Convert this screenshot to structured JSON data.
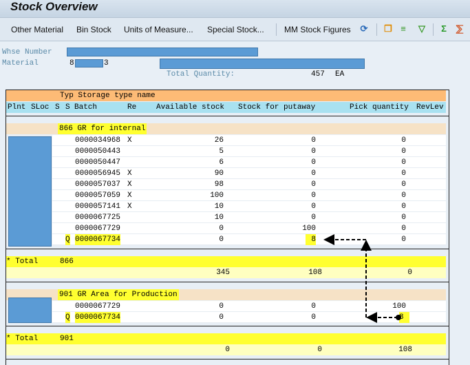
{
  "title": "Stock Overview",
  "toolbar": {
    "other_material": "Other Material",
    "bin_stock": "Bin Stock",
    "units": "Units of Measure...",
    "special": "Special Stock...",
    "mm": "MM Stock Figures"
  },
  "header": {
    "whse_label": "Whse Number",
    "material_label": "Material",
    "material_prefix": "8",
    "material_suffix": "3",
    "total_qty_label": "Total Quantity:",
    "total_qty": "457",
    "uom": "EA"
  },
  "table": {
    "header1": "Typ Storage type name",
    "header2": {
      "plnt": "Plnt",
      "sloc": "SLoc",
      "s1": "S",
      "s2": "S",
      "batch": "Batch",
      "re": "Re",
      "avail": "Available stock",
      "putaway": "Stock for putaway",
      "pick": "Pick quantity",
      "revlev": "RevLev"
    },
    "groups": [
      {
        "title": "866 GR for internal",
        "rows": [
          {
            "q": "",
            "batch": "0000034968",
            "re": "X",
            "avail": "26",
            "putaway": "0",
            "pick": "0"
          },
          {
            "q": "",
            "batch": "0000050443",
            "re": "",
            "avail": "5",
            "putaway": "0",
            "pick": "0"
          },
          {
            "q": "",
            "batch": "0000050447",
            "re": "",
            "avail": "6",
            "putaway": "0",
            "pick": "0"
          },
          {
            "q": "",
            "batch": "0000056945",
            "re": "X",
            "avail": "90",
            "putaway": "0",
            "pick": "0"
          },
          {
            "q": "",
            "batch": "0000057037",
            "re": "X",
            "avail": "98",
            "putaway": "0",
            "pick": "0"
          },
          {
            "q": "",
            "batch": "0000057059",
            "re": "X",
            "avail": "100",
            "putaway": "0",
            "pick": "0"
          },
          {
            "q": "",
            "batch": "0000057141",
            "re": "X",
            "avail": "10",
            "putaway": "0",
            "pick": "0"
          },
          {
            "q": "",
            "batch": "0000067725",
            "re": "",
            "avail": "10",
            "putaway": "0",
            "pick": "0"
          },
          {
            "q": "",
            "batch": "0000067729",
            "re": "",
            "avail": "0",
            "putaway": "100",
            "pick": "0"
          },
          {
            "q": "Q",
            "batch": "0000067734",
            "re": "",
            "avail": "0",
            "putaway": "8",
            "pick": "0"
          }
        ],
        "total_label": "* Total",
        "total_code": "866",
        "total": {
          "avail": "345",
          "putaway": "108",
          "pick": "0"
        }
      },
      {
        "title": "901 GR Area for Production",
        "rows": [
          {
            "q": "",
            "batch": "0000067729",
            "re": "",
            "avail": "0",
            "putaway": "0",
            "pick": "100"
          },
          {
            "q": "Q",
            "batch": "0000067734",
            "re": "",
            "avail": "0",
            "putaway": "0",
            "pick": "8"
          }
        ],
        "total_label": "* Total",
        "total_code": "901",
        "total": {
          "avail": "0",
          "putaway": "0",
          "pick": "108"
        }
      }
    ]
  },
  "colors": {
    "highlight": "#ffff30",
    "orange_header": "#fdbb76",
    "blue_header": "#a9e1f0",
    "group_header": "#f6e2c6",
    "redaction": "#5b9bd5"
  }
}
